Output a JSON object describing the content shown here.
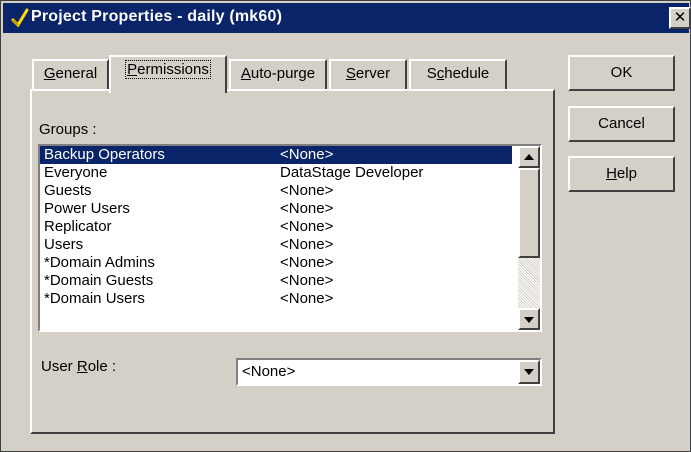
{
  "window": {
    "title": "Project Properties - daily (mk60)",
    "close_glyph": "✕"
  },
  "tabs": [
    {
      "label": "General",
      "mnemonic": "G",
      "rest": "eneral",
      "active": false
    },
    {
      "label": "Permissions",
      "mnemonic": "P",
      "rest": "ermissions",
      "active": true
    },
    {
      "label": "Auto-purge",
      "mnemonic": "A",
      "rest": "uto-purge",
      "active": false
    },
    {
      "label": "Server",
      "mnemonic": "S",
      "rest": "erver",
      "active": false
    },
    {
      "label": "Schedule",
      "pre": "S",
      "mnemonic": "c",
      "rest": "hedule",
      "active": false
    }
  ],
  "buttons": {
    "ok": "OK",
    "cancel": "Cancel",
    "help_mnemonic": "H",
    "help_rest": "elp"
  },
  "groups": {
    "label": "Groups :",
    "rows": [
      {
        "name": "Backup Operators",
        "role": "<None>",
        "selected": true
      },
      {
        "name": "Everyone",
        "role": "DataStage Developer",
        "selected": false
      },
      {
        "name": "Guests",
        "role": "<None>",
        "selected": false
      },
      {
        "name": "Power Users",
        "role": "<None>",
        "selected": false
      },
      {
        "name": "Replicator",
        "role": "<None>",
        "selected": false
      },
      {
        "name": "Users",
        "role": "<None>",
        "selected": false
      },
      {
        "name": "*Domain Admins",
        "role": "<None>",
        "selected": false
      },
      {
        "name": "*Domain Guests",
        "role": "<None>",
        "selected": false
      },
      {
        "name": "*Domain Users",
        "role": "<None>",
        "selected": false
      }
    ]
  },
  "user_role": {
    "label_pre": "User ",
    "label_mnemonic": "R",
    "label_rest": "ole :",
    "value": "<None>"
  },
  "colors": {
    "titlebar": "#0a246a",
    "selection": "#0a246a",
    "face": "#d4d0c8"
  }
}
